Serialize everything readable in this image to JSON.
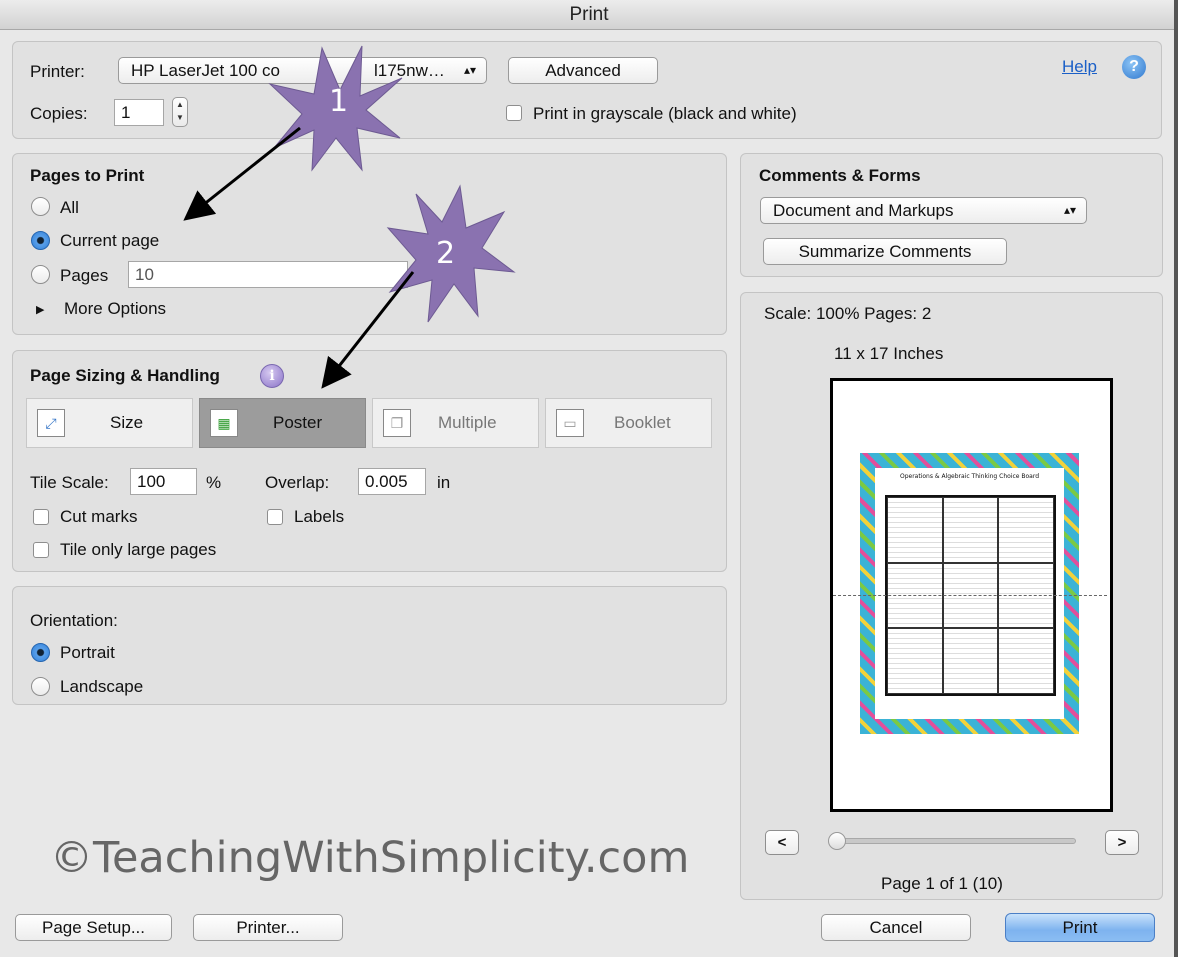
{
  "window": {
    "title": "Print"
  },
  "printer": {
    "label": "Printer:",
    "selected": "HP LaserJet 100 co",
    "selected_suffix": "l175nw…",
    "advanced_button": "Advanced",
    "help_link": "Help",
    "copies_label": "Copies:",
    "copies_value": "1",
    "grayscale_label": "Print in grayscale (black and white)"
  },
  "pages_to_print": {
    "heading": "Pages to Print",
    "all_label": "All",
    "current_label": "Current page",
    "pages_label": "Pages",
    "pages_value": "10",
    "more_options": "More Options",
    "selected": "Current page"
  },
  "sizing": {
    "heading": "Page Sizing & Handling",
    "tabs": [
      {
        "label": "Size"
      },
      {
        "label": "Poster",
        "active": true
      },
      {
        "label": "Multiple"
      },
      {
        "label": "Booklet"
      }
    ],
    "tile_scale_label": "Tile Scale:",
    "tile_scale_value": "100",
    "tile_scale_unit": "%",
    "overlap_label": "Overlap:",
    "overlap_value": "0.005",
    "overlap_unit": "in",
    "cut_marks": "Cut marks",
    "labels": "Labels",
    "tile_only_large": "Tile only large pages"
  },
  "orientation": {
    "heading": "Orientation:",
    "portrait": "Portrait",
    "landscape": "Landscape",
    "selected": "Portrait"
  },
  "comments": {
    "heading": "Comments & Forms",
    "selected": "Document and Markups",
    "summarize_button": "Summarize Comments"
  },
  "preview": {
    "scale_text": "Scale: 100% Pages: 2",
    "paper_size": "11 x 17 Inches",
    "page_indicator": "Page 1 of 1 (10)",
    "prev": "<",
    "next": ">",
    "thumbnail_title": "Operations & Algebraic Thinking Choice Board"
  },
  "footer": {
    "page_setup": "Page Setup...",
    "printer": "Printer...",
    "cancel": "Cancel",
    "print": "Print"
  },
  "annotations": {
    "star1": "1",
    "star2": "2"
  },
  "watermark": "©TeachingWithSimplicity.com",
  "colors": {
    "star": "#8a72b0",
    "accent": "#3a86d8",
    "print_button": "#7eb3ef"
  }
}
